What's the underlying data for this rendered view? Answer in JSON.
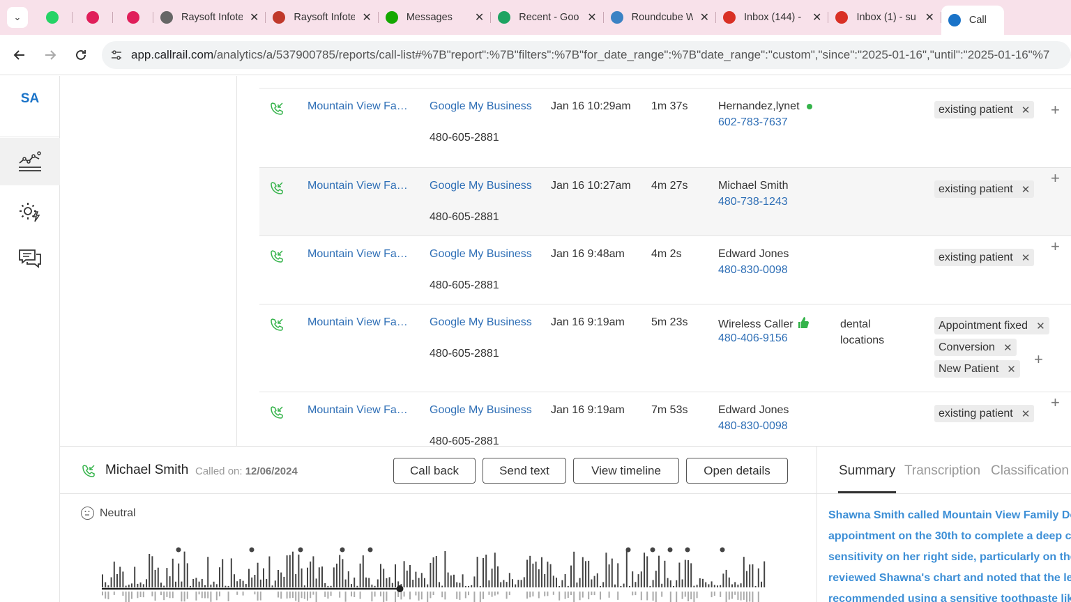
{
  "browser": {
    "tabs": [
      {
        "title": "",
        "favicon": "whatsapp-icon",
        "color": "#25D366",
        "icon_only": true
      },
      {
        "title": "",
        "favicon": "slack-icon",
        "color": "#e01e5a",
        "icon_only": true
      },
      {
        "title": "",
        "favicon": "slack-icon",
        "color": "#e01e5a",
        "icon_only": true
      },
      {
        "title": "Raysoft Infote",
        "favicon": "globe-icon",
        "color": "#666666"
      },
      {
        "title": "Raysoft Infote",
        "favicon": "graduation-cap-icon",
        "color": "#c0392b"
      },
      {
        "title": "Messages",
        "favicon": "upwork-icon",
        "color": "#14a800"
      },
      {
        "title": "Recent - Goo",
        "favicon": "google-drive-icon",
        "color": "#1ea362"
      },
      {
        "title": "Roundcube W",
        "favicon": "roundcube-icon",
        "color": "#3b82c4"
      },
      {
        "title": "Inbox (144) -",
        "favicon": "gmail-icon",
        "color": "#d93025"
      },
      {
        "title": "Inbox (1) - su",
        "favicon": "gmail-icon",
        "color": "#d93025"
      },
      {
        "title": "Call",
        "favicon": "callrail-icon",
        "color": "#1a73c8",
        "active": true
      }
    ],
    "url_host": "app.callrail.com",
    "url_path": "/analytics/a/537900785/reports/call-list#%7B\"report\":%7B\"filters\":%7B\"for_date_range\":%7B\"date_range\":\"custom\",\"since\":\"2025-01-16\",\"until\":\"2025-01-16\"%7"
  },
  "rail": {
    "initials": "SA"
  },
  "calls": [
    {
      "company": "Mountain View Fa…",
      "source": "Google My Business",
      "tracking": "480-605-2881",
      "date": "Jan 16 10:29am",
      "duration": "1m 37s",
      "caller": "Hernandez,lynet",
      "phone": "602-783-7637",
      "status": "online",
      "keywords": "",
      "tags": [
        "existing patient"
      ]
    },
    {
      "company": "Mountain View Fa…",
      "source": "Google My Business",
      "tracking": "480-605-2881",
      "date": "Jan 16 10:27am",
      "duration": "4m 27s",
      "caller": "Michael Smith",
      "phone": "480-738-1243",
      "status": "",
      "keywords": "",
      "tags": [
        "existing patient"
      ],
      "highlighted": true
    },
    {
      "company": "Mountain View Fa…",
      "source": "Google My Business",
      "tracking": "480-605-2881",
      "date": "Jan 16 9:48am",
      "duration": "4m 2s",
      "caller": "Edward Jones",
      "phone": "480-830-0098",
      "status": "",
      "keywords": "",
      "tags": [
        "existing patient"
      ]
    },
    {
      "company": "Mountain View Fa…",
      "source": "Google My Business",
      "tracking": "480-605-2881",
      "date": "Jan 16 9:19am",
      "duration": "5m 23s",
      "caller": "Wireless Caller",
      "phone": "480-406-9156",
      "status": "thumbs-up",
      "keywords": "dental locations",
      "tags": [
        "Appointment fixed",
        "Conversion",
        "New Patient"
      ]
    },
    {
      "company": "Mountain View Fa…",
      "source": "Google My Business",
      "tracking": "480-605-2881",
      "date": "Jan 16 9:19am",
      "duration": "7m 53s",
      "caller": "Edward Jones",
      "phone": "480-830-0098",
      "status": "",
      "keywords": "",
      "tags": [
        "existing patient"
      ]
    }
  ],
  "detail": {
    "caller_name": "Michael Smith",
    "called_on_label": "Called on:",
    "called_on_date": "12/06/2024",
    "buttons": {
      "call_back": "Call back",
      "send_text": "Send text",
      "view_timeline": "View timeline",
      "open_details": "Open details"
    },
    "sentiment": "Neutral",
    "tabs": {
      "summary": "Summary",
      "transcription": "Transcription",
      "classification": "Classification"
    },
    "summary_lines": [
      "Shawna Smith called Mountain View Family De",
      "appointment on the 30th to complete a deep cl",
      "sensitivity on her right side, particularly on the",
      "reviewed Shawna's chart and noted that the le",
      "recommended using a sensitive toothpaste lik"
    ],
    "playback_position": 0.45
  },
  "colors": {
    "link": "#2f6fb6",
    "brand": "#1a73c8",
    "summary": "#3d8fd6",
    "online": "#34b34a",
    "thumbs": "#34b34a"
  }
}
